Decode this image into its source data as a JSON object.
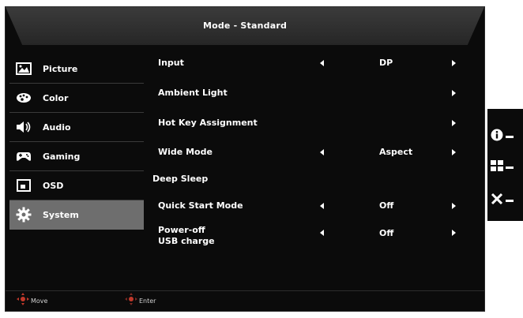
{
  "header": {
    "title": "Mode - Standard"
  },
  "sidebar": {
    "items": [
      {
        "label": "Picture",
        "icon": "picture-icon"
      },
      {
        "label": "Color",
        "icon": "palette-icon"
      },
      {
        "label": "Audio",
        "icon": "speaker-icon"
      },
      {
        "label": "Gaming",
        "icon": "gamepad-icon"
      },
      {
        "label": "OSD",
        "icon": "osd-icon"
      },
      {
        "label": "System",
        "icon": "gear-icon",
        "active": true
      }
    ]
  },
  "settings": {
    "input": {
      "label": "Input",
      "value": "DP"
    },
    "ambient_light": {
      "label": "Ambient Light"
    },
    "hot_key": {
      "label": "Hot Key Assignment"
    },
    "wide_mode": {
      "label": "Wide Mode",
      "value": "Aspect"
    },
    "deep_sleep": {
      "label": "Deep Sleep"
    },
    "quick_start": {
      "label": "Quick Start Mode",
      "value": "Off"
    },
    "power_off_usb": {
      "label_line1": "Power-off",
      "label_line2": "USB charge",
      "value": "Off"
    }
  },
  "footer": {
    "move_label": "Move",
    "enter_label": "Enter"
  },
  "side_panel": {
    "buttons": [
      {
        "icon": "info-icon"
      },
      {
        "icon": "menu-grid-icon"
      },
      {
        "icon": "close-icon"
      }
    ]
  },
  "colors": {
    "background": "#0b0b0b",
    "highlight": "#6e6e6e",
    "nav_accent": "#c0392b"
  }
}
